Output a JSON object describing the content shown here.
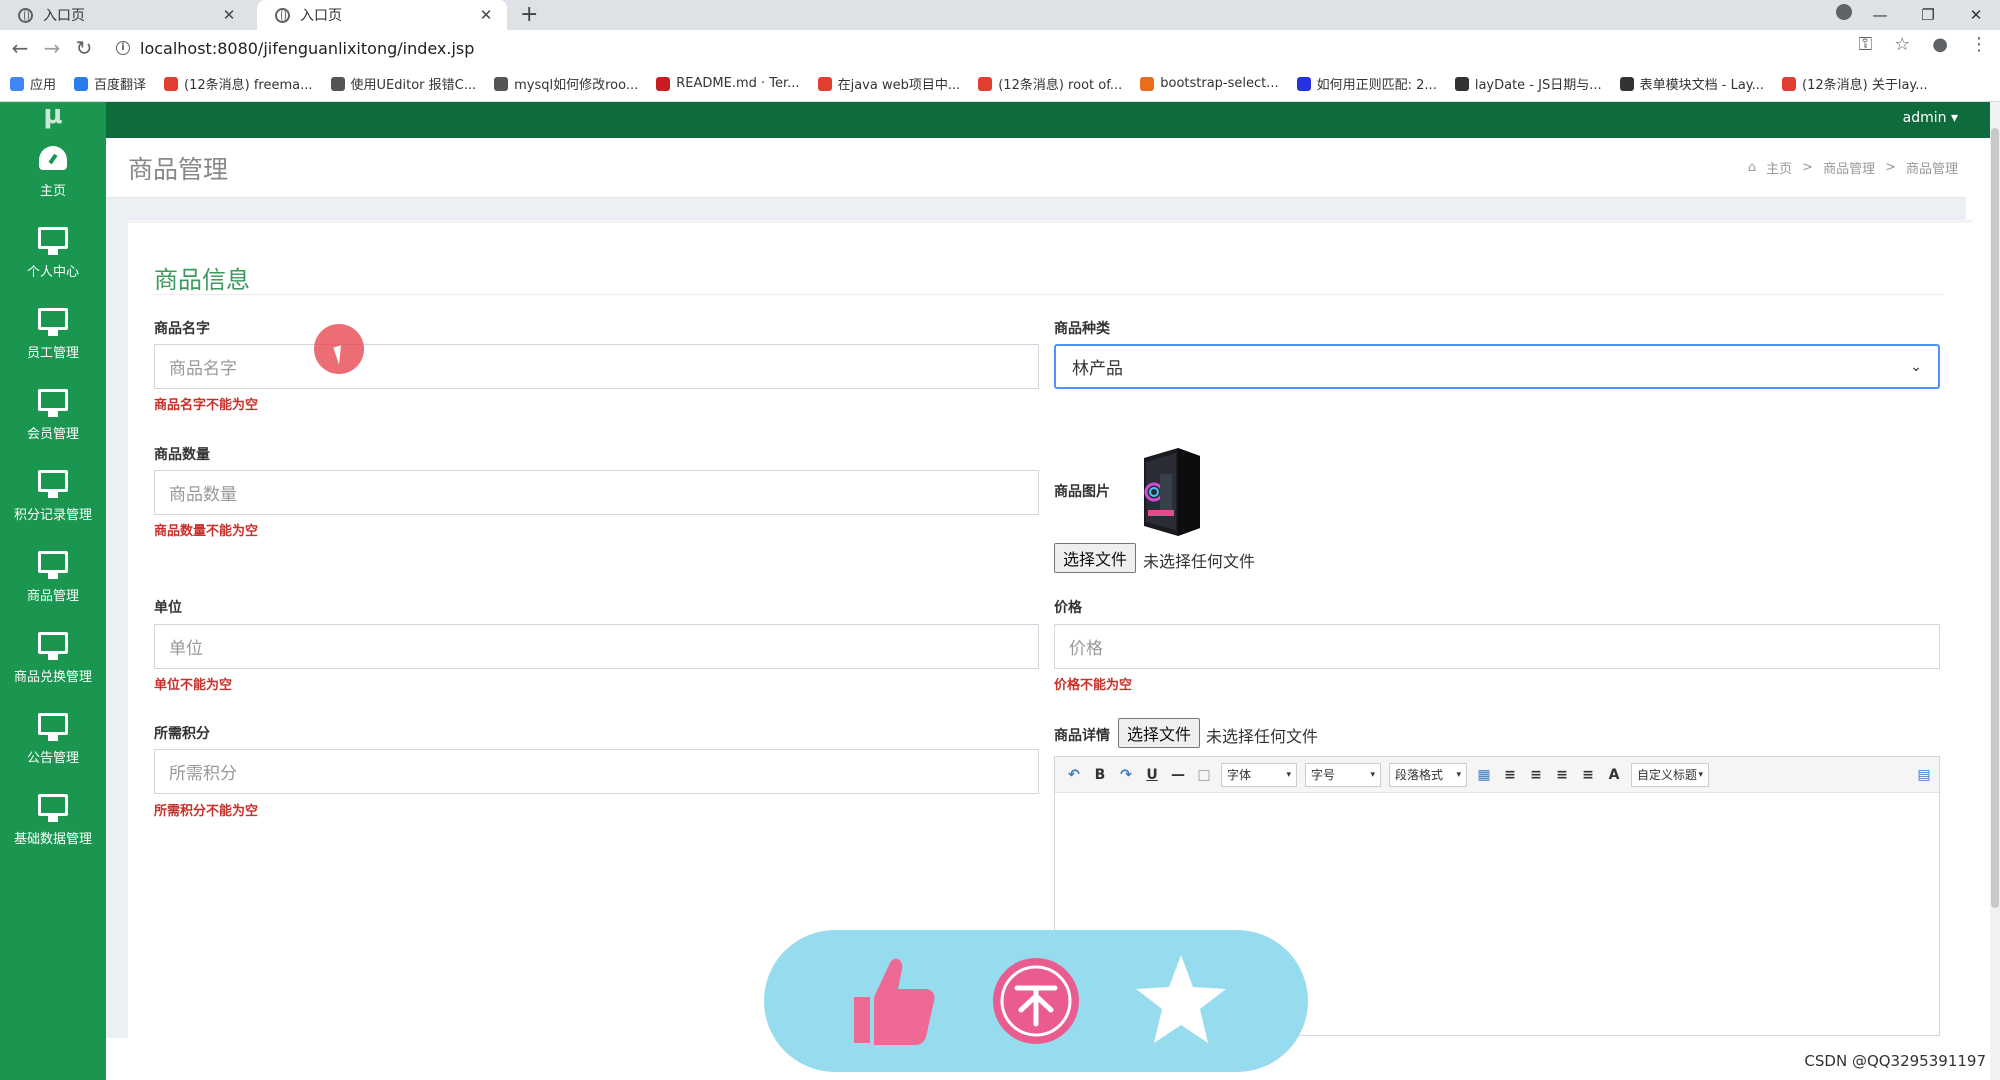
{
  "browser": {
    "tabs": [
      {
        "title": "入口页",
        "active": false
      },
      {
        "title": "入口页",
        "active": true
      }
    ],
    "new_tab": "+",
    "url": "localhost:8080/jifenguanlixitong/index.jsp",
    "bookmarks": [
      {
        "label": "应用",
        "icon": "apps-grid-icon",
        "color": "#4285f4"
      },
      {
        "label": "百度翻译",
        "icon": "baidu-translate-icon",
        "color": "#2b7de9"
      },
      {
        "label": "(12条消息) freema...",
        "icon": "csdn-icon",
        "color": "#e33e33"
      },
      {
        "label": "使用UEditor 报错C...",
        "icon": "loading-icon",
        "color": "#555555"
      },
      {
        "label": "mysql如何修改roo...",
        "icon": "loading-icon",
        "color": "#555555"
      },
      {
        "label": "README.md · Ter...",
        "icon": "gitee-icon",
        "color": "#c71d23"
      },
      {
        "label": "在java web项目中...",
        "icon": "csdn-icon",
        "color": "#e33e33"
      },
      {
        "label": "(12条消息) root of...",
        "icon": "csdn-icon",
        "color": "#e33e33"
      },
      {
        "label": "bootstrap-select...",
        "icon": "doc-icon",
        "color": "#e66e1c"
      },
      {
        "label": "如何用正则匹配: 2...",
        "icon": "baidu-paw-icon",
        "color": "#2932e1"
      },
      {
        "label": "layDate - JS日期与...",
        "icon": "layui-icon",
        "color": "#333333"
      },
      {
        "label": "表单模块文档 - Lay...",
        "icon": "layui-icon",
        "color": "#333333"
      },
      {
        "label": "(12条消息) 关于lay...",
        "icon": "csdn-icon",
        "color": "#e33e33"
      }
    ]
  },
  "app": {
    "logo": "μ",
    "admin": "admin ▾",
    "sidebar": [
      {
        "label": "主页",
        "icon": "dashboard-icon"
      },
      {
        "label": "个人中心",
        "icon": "monitor-icon"
      },
      {
        "label": "员工管理",
        "icon": "monitor-icon"
      },
      {
        "label": "会员管理",
        "icon": "monitor-icon"
      },
      {
        "label": "积分记录管理",
        "icon": "monitor-icon"
      },
      {
        "label": "商品管理",
        "icon": "monitor-icon"
      },
      {
        "label": "商品兑换管理",
        "icon": "monitor-icon"
      },
      {
        "label": "公告管理",
        "icon": "monitor-icon"
      },
      {
        "label": "基础数据管理",
        "icon": "monitor-icon"
      }
    ],
    "page_title": "商品管理",
    "breadcrumb": [
      "主页",
      "商品管理",
      "商品管理"
    ],
    "breadcrumb_sep": ">",
    "card_title": "商品信息",
    "form": {
      "name": {
        "label": "商品名字",
        "placeholder": "商品名字",
        "error": "商品名字不能为空"
      },
      "category": {
        "label": "商品种类",
        "value": "林产品"
      },
      "quantity": {
        "label": "商品数量",
        "placeholder": "商品数量",
        "error": "商品数量不能为空"
      },
      "image": {
        "label": "商品图片",
        "choose": "选择文件",
        "status": "未选择任何文件"
      },
      "unit": {
        "label": "单位",
        "placeholder": "单位",
        "error": "单位不能为空"
      },
      "price": {
        "label": "价格",
        "placeholder": "价格",
        "error": "价格不能为空"
      },
      "points": {
        "label": "所需积分",
        "placeholder": "所需积分",
        "error": "所需积分不能为空"
      },
      "detail": {
        "label": "商品详情",
        "choose": "选择文件",
        "status": "未选择任何文件"
      }
    },
    "editor_toolbar": {
      "buttons": [
        "↶",
        "B",
        "↷",
        "U",
        "—",
        "□"
      ],
      "font": "字体",
      "size": "字号",
      "paragraph": "段落格式",
      "font_color": "A",
      "custom_title": "自定义标题"
    }
  },
  "colors": {
    "sidebar": "#1a9650",
    "topbar": "#0e6b3c",
    "accent_title": "#3c9a5e",
    "error": "#c9302c",
    "overlay": "#96dcee",
    "thumb": "#ee6a94"
  },
  "watermark": "CSDN @QQ3295391197"
}
